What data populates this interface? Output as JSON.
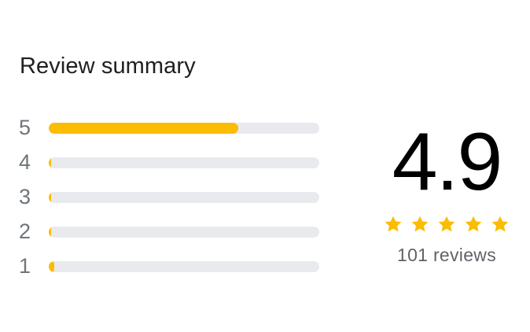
{
  "header": {
    "title": "Review summary"
  },
  "colors": {
    "accent": "#fbbc04",
    "track": "#e8eaed",
    "label": "#70757a"
  },
  "distribution": [
    {
      "label": "5",
      "fraction": 0.7
    },
    {
      "label": "4",
      "fraction": 0.01
    },
    {
      "label": "3",
      "fraction": 0.01
    },
    {
      "label": "2",
      "fraction": 0.01
    },
    {
      "label": "1",
      "fraction": 0.02
    }
  ],
  "summary": {
    "average": "4.9",
    "stars": 5,
    "star_icon": "star-icon",
    "count_text": "101 reviews"
  }
}
